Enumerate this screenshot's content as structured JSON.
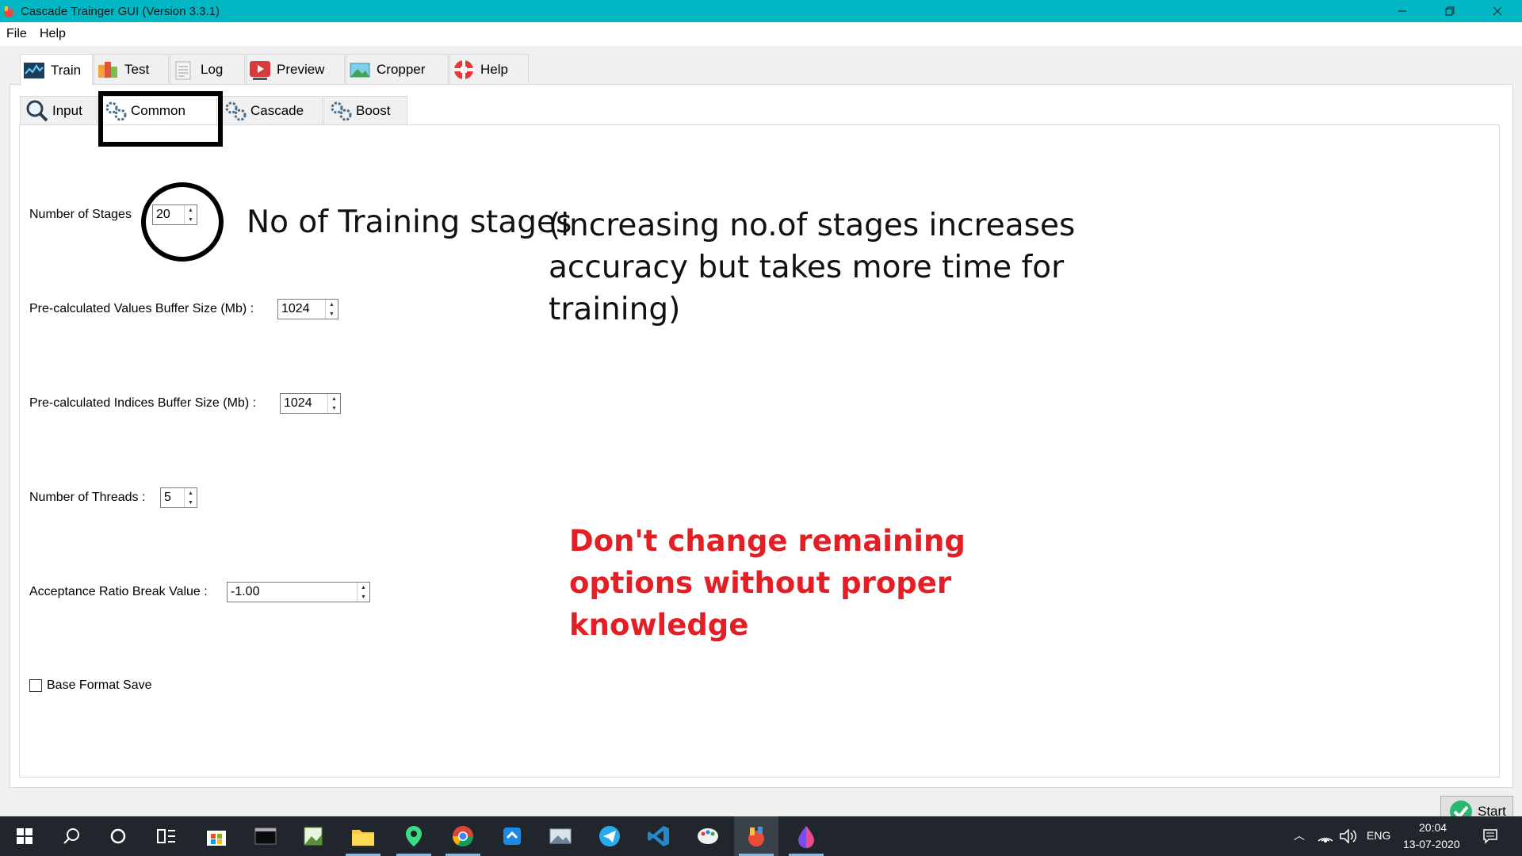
{
  "window": {
    "title": "Cascade Trainger GUI (Version 3.3.1)",
    "controls": [
      "minimize",
      "restore",
      "close"
    ]
  },
  "menu": [
    "File",
    "Help"
  ],
  "main_tabs": [
    {
      "label": "Train",
      "icon": "train-chart-icon",
      "active": true
    },
    {
      "label": "Test",
      "icon": "test-cubes-icon",
      "active": false
    },
    {
      "label": "Log",
      "icon": "log-document-icon",
      "active": false
    },
    {
      "label": "Preview",
      "icon": "preview-play-icon",
      "active": false
    },
    {
      "label": "Cropper",
      "icon": "cropper-image-icon",
      "active": false
    },
    {
      "label": "Help",
      "icon": "help-lifebuoy-icon",
      "active": false
    }
  ],
  "sub_tabs": [
    {
      "label": "Input",
      "icon": "magnifier-icon",
      "active": false
    },
    {
      "label": "Common",
      "icon": "gears-icon",
      "active": true
    },
    {
      "label": "Cascade",
      "icon": "gears-icon",
      "active": false
    },
    {
      "label": "Boost",
      "icon": "gears-icon",
      "active": false
    }
  ],
  "fields": {
    "stages": {
      "label": "Number of Stages",
      "value": "20"
    },
    "values_buffer": {
      "label": "Pre-calculated Values Buffer Size (Mb) :",
      "value": "1024"
    },
    "indices_buffer": {
      "label": "Pre-calculated Indices Buffer Size (Mb) :",
      "value": "1024"
    },
    "threads": {
      "label": "Number of Threads :",
      "value": "5"
    },
    "acceptance": {
      "label": "Acceptance Ratio Break Value :",
      "value": "-1.00"
    },
    "base_format": {
      "label": "Base Format Save",
      "checked": false
    }
  },
  "annotations": {
    "training_stages": "No of Training stages",
    "note_line1": "(increasing no.of stages increases",
    "note_line2": "accuracy but takes more time for",
    "note_line3": "training)",
    "warning_line1": "Don't change remaining",
    "warning_line2": "options without proper",
    "warning_line3": "knowledge"
  },
  "start_button": {
    "label": "Start"
  },
  "taskbar": {
    "apps": [
      "start-icon",
      "search-icon",
      "cortana-icon",
      "task-view-icon",
      "store-icon",
      "terminal-icon",
      "image-editor-icon",
      "file-explorer-icon",
      "maps-icon",
      "chrome-icon",
      "sync-icon",
      "photos-icon",
      "telegram-icon",
      "vscode-icon",
      "paint-icon",
      "cascade-trainer-icon",
      "color-drop-icon"
    ],
    "language": "ENG",
    "time": "20:04",
    "date": "13-07-2020"
  },
  "colors": {
    "titlebar": "#00b7c3",
    "annotation_red": "#e31e24",
    "taskbar": "#20262c"
  }
}
